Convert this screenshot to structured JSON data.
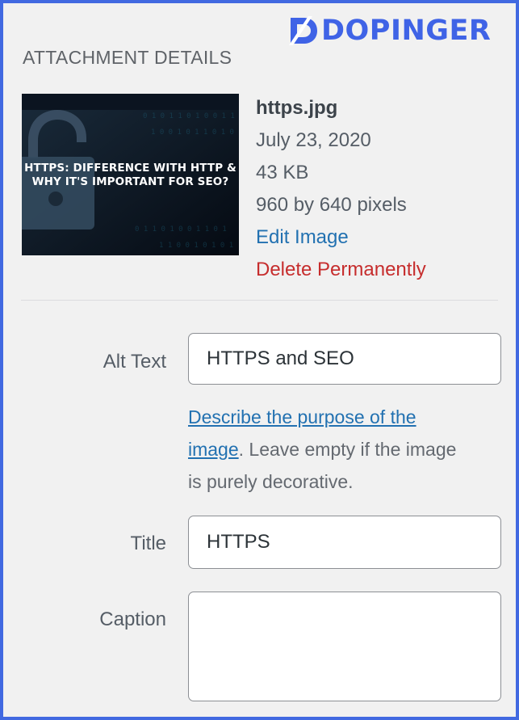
{
  "brand": {
    "name": "DOPINGER",
    "color": "#3f63e6"
  },
  "panel": {
    "title": "ATTACHMENT DETAILS"
  },
  "thumbnail": {
    "caption_line1": "HTTPS: DIFFERENCE WITH HTTP &",
    "caption_line2": "WHY IT'S IMPORTANT FOR SEO?",
    "icon": "padlock-icon"
  },
  "file": {
    "name": "https.jpg",
    "date": "July 23, 2020",
    "size": "43 KB",
    "dimensions": "960 by 640 pixels",
    "edit_label": "Edit Image",
    "delete_label": "Delete Permanently"
  },
  "fields": {
    "alt_text": {
      "label": "Alt Text",
      "value": "HTTPS and SEO"
    },
    "alt_help": {
      "link_line1": "Describe the purpose of the",
      "link_line2": "image",
      "rest_line2": ". Leave empty if the image",
      "line3": "is purely decorative."
    },
    "title": {
      "label": "Title",
      "value": "HTTPS"
    },
    "caption": {
      "label": "Caption",
      "value": ""
    }
  },
  "colors": {
    "link": "#2271b1",
    "delete": "#c62d2d",
    "frame": "#4169e1"
  }
}
